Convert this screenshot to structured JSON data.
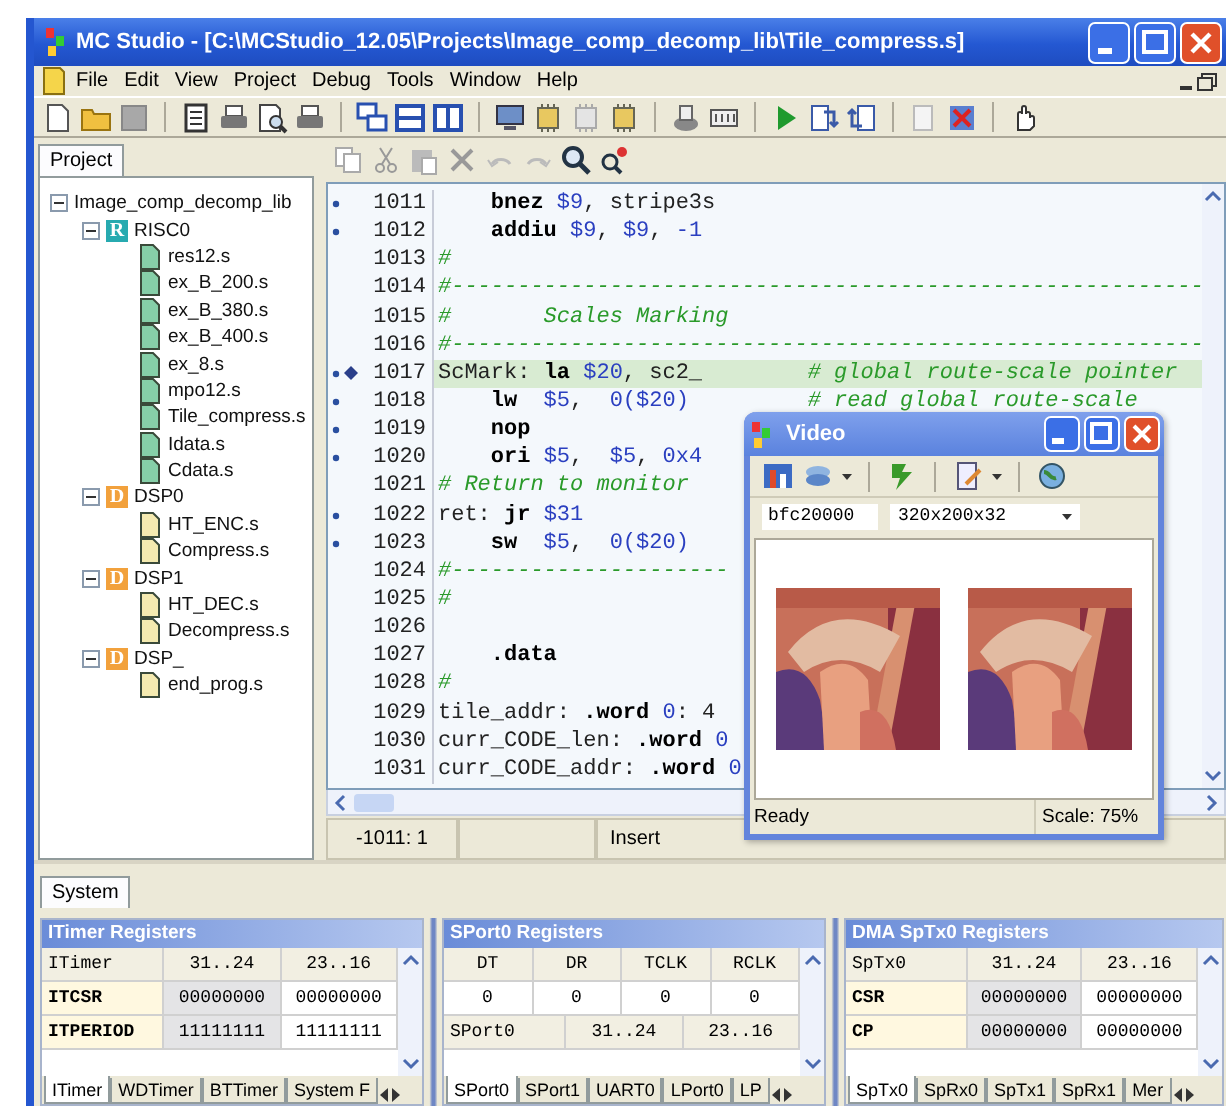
{
  "window": {
    "title": "MC Studio - [C:\\MCStudio_12.05\\Projects\\Image_comp_decomp_lib\\Tile_compress.s]"
  },
  "menu": [
    "File",
    "Edit",
    "View",
    "Project",
    "Debug",
    "Tools",
    "Window",
    "Help"
  ],
  "project": {
    "tab": "Project",
    "tree": [
      {
        "label": "Image_comp_decomp_lib",
        "expanded": true,
        "children": [
          {
            "label": "RISC0",
            "kind": "core",
            "badge": "R",
            "color": "#27aab0",
            "expanded": true,
            "children": [
              {
                "label": "res12.s",
                "kind": "file",
                "color": "#86cfa8"
              },
              {
                "label": "ex_B_200.s",
                "kind": "file",
                "color": "#86cfa8"
              },
              {
                "label": "ex_B_380.s",
                "kind": "file",
                "color": "#86cfa8"
              },
              {
                "label": "ex_B_400.s",
                "kind": "file",
                "color": "#86cfa8"
              },
              {
                "label": "ex_8.s",
                "kind": "file",
                "color": "#86cfa8"
              },
              {
                "label": "mpo12.s",
                "kind": "file",
                "color": "#86cfa8"
              },
              {
                "label": "Tile_compress.s",
                "kind": "file",
                "color": "#86cfa8"
              },
              {
                "label": "Idata.s",
                "kind": "file",
                "color": "#86cfa8"
              },
              {
                "label": "Cdata.s",
                "kind": "file",
                "color": "#86cfa8"
              }
            ]
          },
          {
            "label": "DSP0",
            "kind": "core",
            "badge": "D",
            "color": "#f2a13c",
            "expanded": true,
            "children": [
              {
                "label": "HT_ENC.s",
                "kind": "file",
                "color": "#f4eab0"
              },
              {
                "label": "Compress.s",
                "kind": "file",
                "color": "#f4eab0"
              }
            ]
          },
          {
            "label": "DSP1",
            "kind": "core",
            "badge": "D",
            "color": "#f2a13c",
            "expanded": true,
            "children": [
              {
                "label": "HT_DEC.s",
                "kind": "file",
                "color": "#f4eab0"
              },
              {
                "label": "Decompress.s",
                "kind": "file",
                "color": "#f4eab0"
              }
            ]
          },
          {
            "label": "DSP_",
            "kind": "core",
            "badge": "D",
            "color": "#f2a13c",
            "expanded": true,
            "children": [
              {
                "label": "end_prog.s",
                "kind": "file",
                "color": "#f4eab0"
              }
            ]
          }
        ]
      }
    ]
  },
  "editor": {
    "position": "-1011: 1",
    "mode": "Insert",
    "lines": [
      {
        "number": "1011",
        "marked": true,
        "breakpoint": false,
        "current": false,
        "tokens": [
          {
            "kind": "kw",
            "text": "    bnez"
          },
          {
            "kind": "reg",
            "text": " $9"
          },
          {
            "kind": "plain",
            "text": ", stripe3s"
          }
        ]
      },
      {
        "number": "1012",
        "marked": true,
        "breakpoint": false,
        "current": false,
        "tokens": [
          {
            "kind": "kw",
            "text": "    addiu"
          },
          {
            "kind": "reg",
            "text": " $9"
          },
          {
            "kind": "plain",
            "text": ", "
          },
          {
            "kind": "reg",
            "text": "$9"
          },
          {
            "kind": "plain",
            "text": ", "
          },
          {
            "kind": "reg",
            "text": "-1"
          }
        ]
      },
      {
        "number": "1013",
        "marked": false,
        "breakpoint": false,
        "current": false,
        "tokens": [
          {
            "kind": "comment",
            "text": "#"
          }
        ]
      },
      {
        "number": "1014",
        "marked": false,
        "breakpoint": false,
        "current": false,
        "tokens": [
          {
            "kind": "comment",
            "text": "#---------------------------------------------------------"
          }
        ]
      },
      {
        "number": "1015",
        "marked": false,
        "breakpoint": false,
        "current": false,
        "tokens": [
          {
            "kind": "comment",
            "text": "#       Scales Marking"
          }
        ]
      },
      {
        "number": "1016",
        "marked": false,
        "breakpoint": false,
        "current": false,
        "tokens": [
          {
            "kind": "comment",
            "text": "#---------------------------------------------------------"
          }
        ]
      },
      {
        "number": "1017",
        "marked": true,
        "breakpoint": true,
        "current": true,
        "tokens": [
          {
            "kind": "plain",
            "text": "ScMark: "
          },
          {
            "kind": "kw",
            "text": "la"
          },
          {
            "kind": "reg",
            "text": " $20"
          },
          {
            "kind": "plain",
            "text": ", sc2_        "
          },
          {
            "kind": "comment",
            "text": "# global route-scale pointer"
          }
        ]
      },
      {
        "number": "1018",
        "marked": true,
        "breakpoint": false,
        "current": false,
        "tokens": [
          {
            "kind": "kw",
            "text": "    lw"
          },
          {
            "kind": "reg",
            "text": "  $5"
          },
          {
            "kind": "plain",
            "text": ",  "
          },
          {
            "kind": "reg",
            "text": "0($20)"
          },
          {
            "kind": "comment",
            "text": "         # read global route-scale"
          }
        ]
      },
      {
        "number": "1019",
        "marked": true,
        "breakpoint": false,
        "current": false,
        "tokens": [
          {
            "kind": "kw",
            "text": "    nop"
          }
        ]
      },
      {
        "number": "1020",
        "marked": true,
        "breakpoint": false,
        "current": false,
        "tokens": [
          {
            "kind": "kw",
            "text": "    ori"
          },
          {
            "kind": "reg",
            "text": " $5"
          },
          {
            "kind": "plain",
            "text": ",  "
          },
          {
            "kind": "reg",
            "text": "$5"
          },
          {
            "kind": "plain",
            "text": ", "
          },
          {
            "kind": "reg",
            "text": "0x4"
          }
        ]
      },
      {
        "number": "1021",
        "marked": false,
        "breakpoint": false,
        "current": false,
        "tokens": [
          {
            "kind": "comment",
            "text": "# Return to monitor"
          }
        ]
      },
      {
        "number": "1022",
        "marked": true,
        "breakpoint": false,
        "current": false,
        "tokens": [
          {
            "kind": "plain",
            "text": "ret: "
          },
          {
            "kind": "kw",
            "text": "jr"
          },
          {
            "kind": "reg",
            "text": " $31"
          }
        ]
      },
      {
        "number": "1023",
        "marked": true,
        "breakpoint": false,
        "current": false,
        "tokens": [
          {
            "kind": "kw",
            "text": "    sw"
          },
          {
            "kind": "reg",
            "text": "  $5"
          },
          {
            "kind": "plain",
            "text": ",  "
          },
          {
            "kind": "reg",
            "text": "0($20)"
          }
        ]
      },
      {
        "number": "1024",
        "marked": false,
        "breakpoint": false,
        "current": false,
        "tokens": [
          {
            "kind": "comment",
            "text": "#---------------------"
          }
        ]
      },
      {
        "number": "1025",
        "marked": false,
        "breakpoint": false,
        "current": false,
        "tokens": [
          {
            "kind": "comment",
            "text": "#"
          }
        ]
      },
      {
        "number": "1026",
        "marked": false,
        "breakpoint": false,
        "current": false
      },
      {
        "number": "1027",
        "marked": false,
        "breakpoint": false,
        "current": false,
        "tokens": [
          {
            "kind": "kw",
            "text": "    .data"
          }
        ]
      },
      {
        "number": "1028",
        "marked": false,
        "breakpoint": false,
        "current": false,
        "tokens": [
          {
            "kind": "comment",
            "text": "#"
          }
        ]
      },
      {
        "number": "1029",
        "marked": false,
        "breakpoint": false,
        "current": false,
        "tokens": [
          {
            "kind": "plain",
            "text": "tile_addr: "
          },
          {
            "kind": "kw",
            "text": ".word"
          },
          {
            "kind": "reg",
            "text": " 0"
          },
          {
            "kind": "plain",
            "text": ": 4"
          }
        ]
      },
      {
        "number": "1030",
        "marked": false,
        "breakpoint": false,
        "current": false,
        "tokens": [
          {
            "kind": "plain",
            "text": "curr_CODE_len: "
          },
          {
            "kind": "kw",
            "text": ".word"
          },
          {
            "kind": "reg",
            "text": " 0"
          }
        ]
      },
      {
        "number": "1031",
        "marked": false,
        "breakpoint": false,
        "current": false,
        "tokens": [
          {
            "kind": "plain",
            "text": "curr_CODE_addr: "
          },
          {
            "kind": "kw",
            "text": ".word"
          },
          {
            "kind": "reg",
            "text": " 0"
          }
        ]
      }
    ]
  },
  "video": {
    "title": "Video",
    "address": "bfc20000",
    "format": "320x200x32",
    "status": "Ready",
    "scale": "Scale: 75%"
  },
  "bottom": {
    "tab": "System",
    "panels": [
      {
        "title": "ITimer Registers",
        "tables": [
          {
            "rows": [
              {
                "kind": "named-header",
                "cells": [
                  "ITimer",
                  "31..24",
                  "23..16"
                ]
              },
              {
                "kind": "data",
                "cells": [
                  "ITCSR",
                  "00000000",
                  "00000000"
                ]
              },
              {
                "kind": "data",
                "cells": [
                  "ITPERIOD",
                  "11111111",
                  "11111111"
                ]
              }
            ]
          }
        ],
        "tabs": [
          {
            "label": "ITimer",
            "selected": true
          },
          {
            "label": "WDTimer",
            "selected": false
          },
          {
            "label": "BTTimer",
            "selected": false
          },
          {
            "label": "System F",
            "selected": false
          }
        ]
      },
      {
        "title": "SPort0 Registers",
        "tables": [
          {
            "rows": [
              {
                "kind": "header",
                "cells": [
                  "DT",
                  "DR",
                  "TCLK",
                  "RCLK"
                ]
              },
              {
                "kind": "values",
                "cells": [
                  "0",
                  "0",
                  "0",
                  "0"
                ]
              }
            ]
          },
          {
            "rows": [
              {
                "kind": "named-header",
                "cells": [
                  "SPort0",
                  "31..24",
                  "23..16"
                ]
              }
            ]
          }
        ],
        "tabs": [
          {
            "label": "SPort0",
            "selected": true
          },
          {
            "label": "SPort1",
            "selected": false
          },
          {
            "label": "UART0",
            "selected": false
          },
          {
            "label": "LPort0",
            "selected": false
          },
          {
            "label": "LP",
            "selected": false
          }
        ]
      },
      {
        "title": "DMA SpTx0 Registers",
        "tables": [
          {
            "rows": [
              {
                "kind": "named-header",
                "cells": [
                  "SpTx0",
                  "31..24",
                  "23..16"
                ]
              },
              {
                "kind": "data",
                "cells": [
                  "CSR",
                  "00000000",
                  "00000000"
                ]
              },
              {
                "kind": "data",
                "cells": [
                  "CP",
                  "00000000",
                  "00000000"
                ]
              }
            ]
          }
        ],
        "tabs": [
          {
            "label": "SpTx0",
            "selected": true
          },
          {
            "label": "SpRx0",
            "selected": false
          },
          {
            "label": "SpTx1",
            "selected": false
          },
          {
            "label": "SpRx1",
            "selected": false
          },
          {
            "label": "Mer",
            "selected": false
          }
        ]
      }
    ]
  }
}
